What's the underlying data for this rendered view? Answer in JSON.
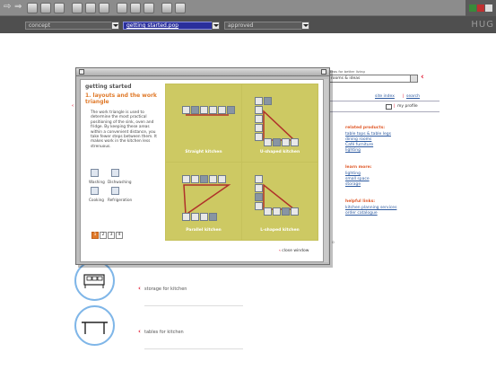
{
  "toolbar": {
    "buttons": [
      "back-icon",
      "forward-icon",
      "history-icon",
      "home-icon",
      "page-icon",
      "find-icon",
      "print-icon",
      "tools-icon",
      "shape-icon",
      "favorites-icon",
      "window-icon",
      "grid-icon"
    ]
  },
  "selectbar": {
    "concept": "concept",
    "document": "getting started.pop",
    "status": "approved",
    "brand": "HUG"
  },
  "background": {
    "select_label": "ideas for better living",
    "select_value": "rooms & ideas",
    "nav_links": [
      "site index",
      "search"
    ],
    "my_profile": "my profile",
    "related_products": {
      "title": "related products:",
      "items": [
        "table tops & table legs",
        "dining rooms",
        "Café furniture",
        "lighting"
      ]
    },
    "learn_more": {
      "title": "learn more:",
      "items": [
        "lighting",
        "small space",
        "storage"
      ]
    },
    "helpful_links": {
      "title": "helpful links:",
      "items": [
        "kitchen planning services",
        "order catalogue"
      ]
    },
    "sections": [
      "storage for kitchen",
      "tables for kitchen"
    ]
  },
  "modal": {
    "title": "getting started",
    "heading": "1. layouts and the work triangle",
    "description": "The work triangle is used to determine the most practical positioning of the sink, oven and fridge. By keeping these areas within a convenient distance, you take fewer steps between them. It makes work in the kitchen less strenuous.",
    "legend": [
      "Washing",
      "Dishwashing",
      "Cooking",
      "Refrigeration"
    ],
    "pages": [
      "1",
      "2",
      "3",
      "4"
    ],
    "current_page": 1,
    "layouts": [
      "Straight kitchen",
      "U-shaped kitchen",
      "Parallel kitchen",
      "L-shaped kitchen"
    ],
    "close_label": "close window"
  },
  "colors": {
    "accent_orange": "#e07a2a",
    "caret_red": "#e0102a",
    "olive_panel": "#c5c15b",
    "link_blue": "#2d5aa0",
    "circle_blue": "#7fb6e8"
  }
}
